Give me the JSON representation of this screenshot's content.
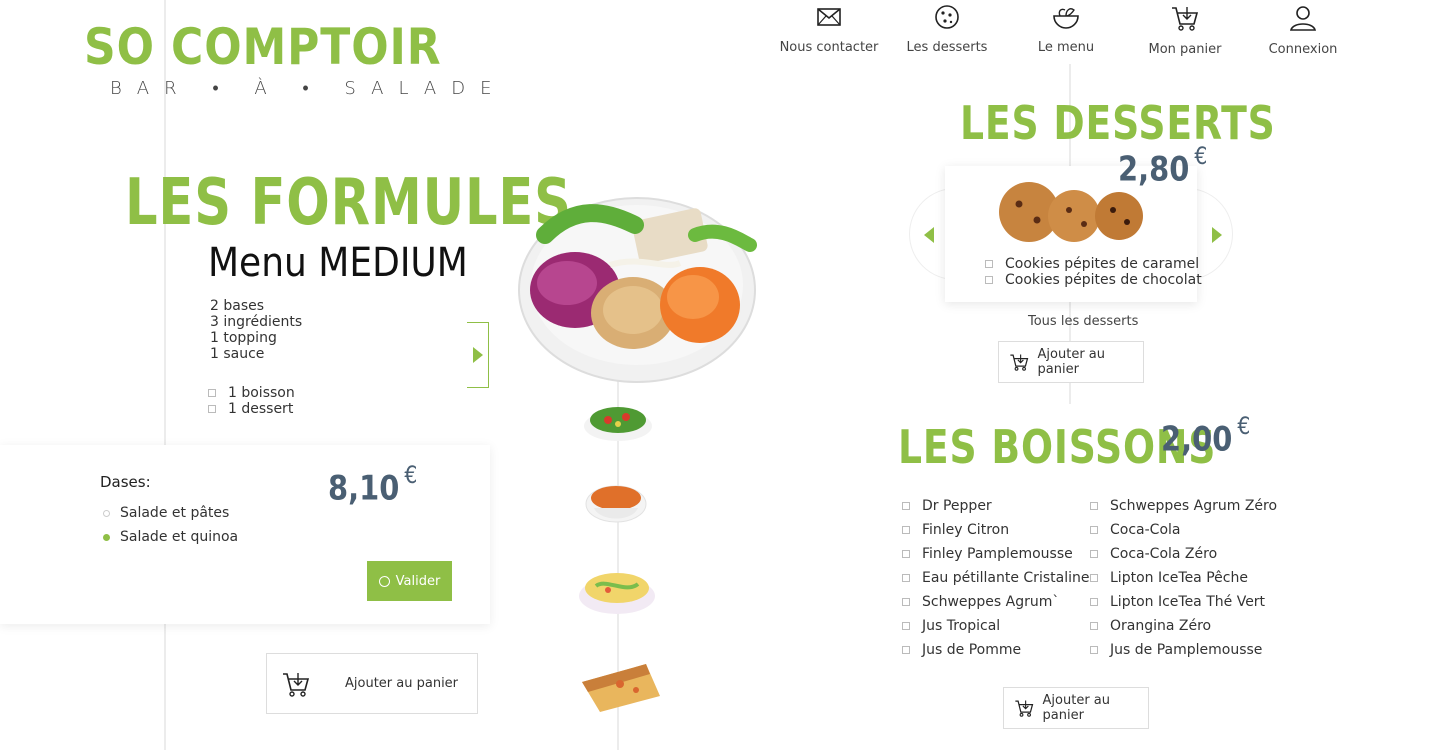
{
  "logo": {
    "title": "SO COMPTOIR",
    "subtitle": "BAR • À • SALADE"
  },
  "nav": [
    {
      "label": "Nous contacter",
      "icon": "envelope-icon"
    },
    {
      "label": "Les desserts",
      "icon": "cookie-icon"
    },
    {
      "label": "Le menu",
      "icon": "salad-bowl-icon"
    },
    {
      "label": "Mon panier",
      "icon": "cart-icon"
    },
    {
      "label": "Connexion",
      "icon": "user-icon"
    }
  ],
  "formules": {
    "heading": "LES FORMULES",
    "menu_title": "Menu MEDIUM",
    "contents": [
      "2 bases",
      "3 ingrédients",
      "1 topping",
      "1 sauce"
    ],
    "extras": [
      "1 boisson",
      "1 dessert"
    ],
    "price": "8,10",
    "currency": "€",
    "bases_label": "Dases:",
    "bases_options": [
      {
        "label": "Salade et pâtes",
        "selected": false
      },
      {
        "label": "Salade et quinoa",
        "selected": true
      }
    ],
    "validate_label": "Valider",
    "add_to_cart": "Ajouter au panier"
  },
  "desserts": {
    "heading": "LES DESSERTS",
    "price": "2,80",
    "currency": "€",
    "items": [
      "Cookies pépites de caramel",
      "Cookies pépites de chocolat"
    ],
    "all_link": "Tous les desserts",
    "add_to_cart": "Ajouter au panier"
  },
  "boissons": {
    "heading": "LES BOISSONS",
    "price": "2,00",
    "currency": "€",
    "col1": [
      "Dr Pepper",
      "Finley Citron",
      "Finley Pamplemousse",
      "Eau pétillante Cristaline",
      "Schweppes Agrum`",
      "Jus Tropical",
      "Jus de Pomme"
    ],
    "col2": [
      "Schweppes Agrum Zéro",
      "Coca-Cola",
      "Coca-Cola Zéro",
      "Lipton IceTea Pêche",
      "Lipton IceTea Thé Vert",
      "Orangina Zéro",
      "Jus de Pamplemousse"
    ],
    "add_to_cart": "Ajouter au panier"
  },
  "colors": {
    "accent": "#8fbf46",
    "price": "#4a5f73"
  }
}
